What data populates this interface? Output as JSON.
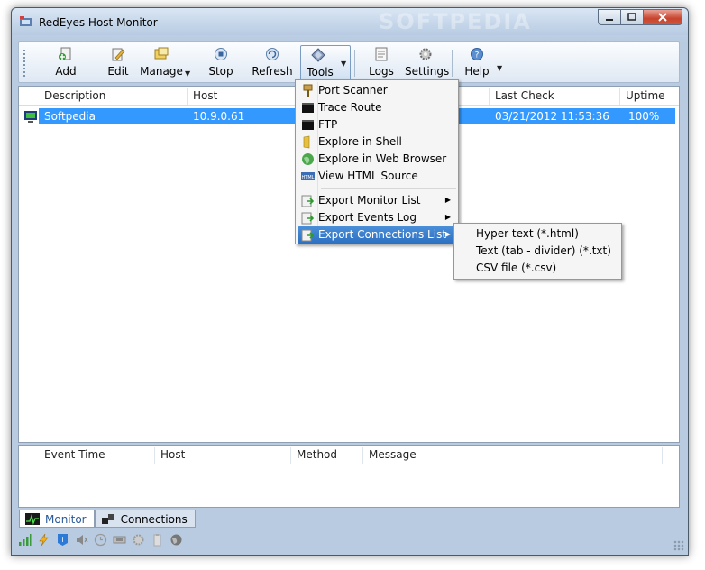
{
  "window": {
    "title": "RedEyes Host Monitor",
    "watermark": "SOFTPEDIA"
  },
  "toolbar": {
    "add": "Add",
    "edit": "Edit",
    "manage": "Manage",
    "stop": "Stop",
    "refresh": "Refresh",
    "tools": "Tools",
    "logs": "Logs",
    "settings": "Settings",
    "help": "Help"
  },
  "hosts": {
    "columns": {
      "description": "Description",
      "host": "Host",
      "last_check": "Last Check",
      "uptime": "Uptime"
    },
    "rows": [
      {
        "description": "Softpedia",
        "host": "10.9.0.61",
        "last_check": "03/21/2012 11:53:36",
        "uptime": "100%"
      }
    ]
  },
  "events": {
    "columns": {
      "event_time": "Event Time",
      "host": "Host",
      "method": "Method",
      "message": "Message"
    }
  },
  "tabs": {
    "monitor": "Monitor",
    "connections": "Connections"
  },
  "tools_menu": {
    "port_scanner": "Port Scanner",
    "trace_route": "Trace Route",
    "ftp": "FTP",
    "explore_shell": "Explore in Shell",
    "explore_web": "Explore in Web Browser",
    "view_html": "View HTML Source",
    "export_monitor": "Export Monitor List",
    "export_events": "Export Events Log",
    "export_connections": "Export Connections List"
  },
  "export_submenu": {
    "html": "Hyper text (*.html)",
    "txt": "Text (tab - divider) (*.txt)",
    "csv": "CSV file (*.csv)"
  },
  "colors": {
    "selection": "#3399ff",
    "menu_highlight": "#2d6fc2",
    "title_bg": "#c5d6e9"
  }
}
